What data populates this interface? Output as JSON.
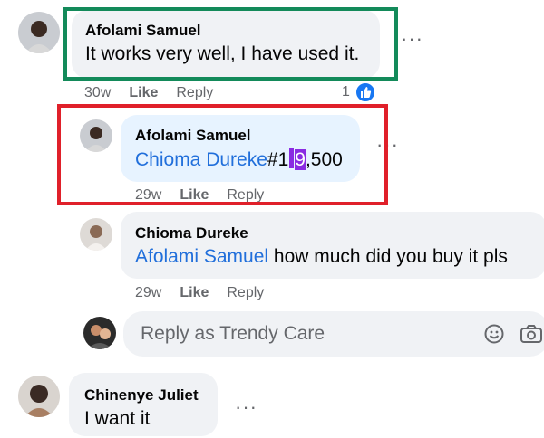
{
  "comments": [
    {
      "author": "Afolami Samuel",
      "text": "It works very well, I have used it.",
      "time": "30w",
      "like_label": "Like",
      "reply_label": "Reply",
      "reactions": "1"
    },
    {
      "author": "Afolami Samuel",
      "mention": "Chioma Dureke",
      "text_before": "#1",
      "text_selected": "9",
      "text_after": ",500",
      "time": "29w",
      "like_label": "Like",
      "reply_label": "Reply"
    },
    {
      "author": "Chioma Dureke",
      "mention": "Afolami Samuel",
      "text": " how much did you buy it pls",
      "time": "29w",
      "like_label": "Like",
      "reply_label": "Reply"
    },
    {
      "author": "Chinenye Juliet",
      "text": "I want it"
    }
  ],
  "reply_box": {
    "placeholder": "Reply as Trendy Care"
  },
  "more_label": "···",
  "colors": {
    "highlight_green": "#138a5a",
    "highlight_red": "#e0202a",
    "mention_blue": "#216fdb",
    "like_badge": "#1877f2",
    "selection": "#8a2be2"
  }
}
